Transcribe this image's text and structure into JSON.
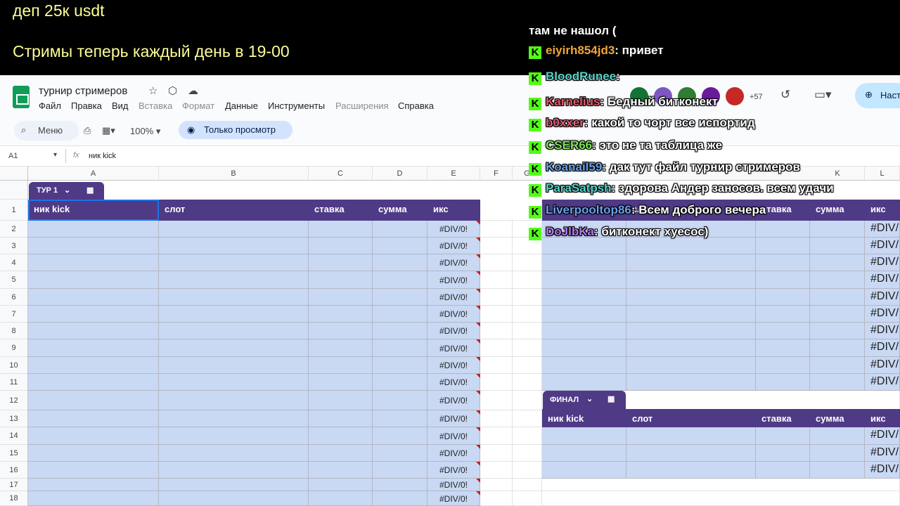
{
  "overlay": {
    "line1": "деп 25к  usdt",
    "line2": "Стримы теперь каждый день в 19-00",
    "text_color": "#fdfd96"
  },
  "app": {
    "title": "турнир стримеров",
    "menu": [
      "Файл",
      "Правка",
      "Вид",
      "Вставка",
      "Формат",
      "Данные",
      "Инструменты",
      "Расширения",
      "Справка"
    ],
    "menu_disabled": [
      "Вставка",
      "Формат",
      "Расширения"
    ],
    "search_label": "Меню",
    "zoom": "100%",
    "view_only_label": "Только просмотр",
    "share_label": "Наст",
    "collaborators_more": "+57",
    "accent": "#4f3a86"
  },
  "formula_bar": {
    "cell_ref": "A1",
    "fx": "fx",
    "value": "ник kick"
  },
  "columns_left": [
    "A",
    "B",
    "C",
    "D",
    "E",
    "F",
    "G"
  ],
  "columns_right": [
    "K",
    "L"
  ],
  "rows": [
    "1",
    "2",
    "3",
    "4",
    "5",
    "6",
    "7",
    "8",
    "9",
    "10",
    "11",
    "12",
    "13",
    "14",
    "15",
    "16",
    "17",
    "18"
  ],
  "table_tur1": {
    "tag": "ТУР 1",
    "headers": [
      "ник kick",
      "слот",
      "ставка",
      "сумма",
      "икс"
    ],
    "error_value": "#DIV/0!",
    "error_rows": 17
  },
  "table_right": {
    "headers": [
      "слот",
      "ставка",
      "сумма",
      "икс"
    ],
    "error_value": "#DIV/",
    "error_rows": 10
  },
  "table_final": {
    "tag": "ФИНАЛ",
    "headers": [
      "ник kick",
      "слот",
      "ставка",
      "сумма",
      "икс"
    ],
    "error_value": "#DIV/",
    "error_rows": 3
  },
  "chat": [
    {
      "user": "",
      "text": "там не нашол (",
      "color": "#ffffff"
    },
    {
      "user": "eiyirh854jd3",
      "text": ": привет",
      "color": "#f0a53a"
    },
    {
      "user": "BloodRunee",
      "text": ":",
      "color": "#5ad2c8"
    },
    {
      "user": "Karnelius",
      "text": ": Бедный битконект",
      "color": "#e05a6a"
    },
    {
      "user": "b0xxer",
      "text": ": какой то чорт все испортид",
      "color": "#e0607a"
    },
    {
      "user": "CSER66",
      "text": ": это не та таблица же",
      "color": "#7fe05a"
    },
    {
      "user": "Koanail59",
      "text": ": дак тут файл турнир стримеров",
      "color": "#6aa0e8"
    },
    {
      "user": "ParaSatpsh",
      "text": ": здорова Андер заносов. всем удачи",
      "color": "#5ad2c8"
    },
    {
      "user": "Liverpooltop86",
      "text": ": Всем доброго вечера",
      "color": "#6aa0e8"
    },
    {
      "user": "DoJlbKa",
      "text": ": битконект хуесос)",
      "color": "#b07ae8"
    }
  ],
  "chat_badge": "K"
}
